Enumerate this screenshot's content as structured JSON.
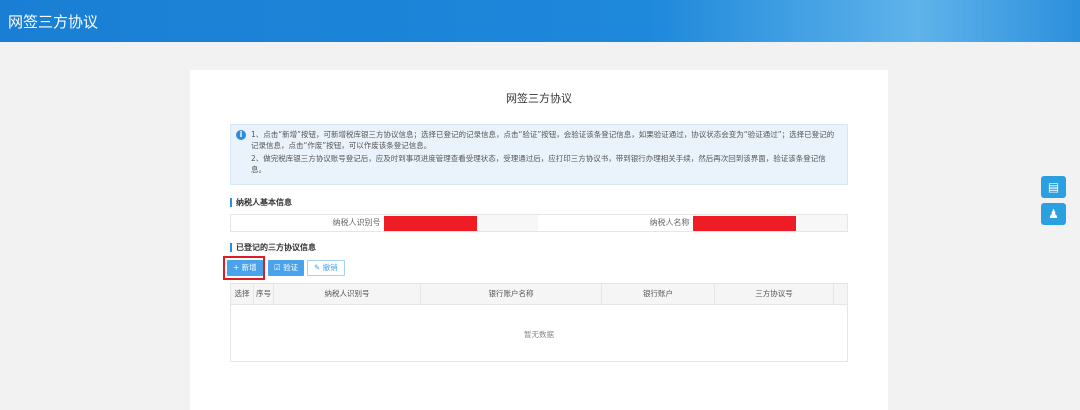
{
  "header": {
    "title": "网签三方协议"
  },
  "page_title": "网签三方协议",
  "notice": {
    "line1": "1、点击“新增”按钮，可新增税库银三方协议信息；选择已登记的记录信息，点击“验证”按钮，会验证该条登记信息，如果验证通过，协议状态会变为“验证通过”；选择已登记的记录信息，点击“作废”按钮，可以作废该条登记信息。",
    "line2": "2、做完税库银三方协议账号登记后，应及时到事项进度管理查看受理状态，受理通过后，应打印三方协议书，带到银行办理相关手续，然后再次回到该界面，验证该条登记信息。"
  },
  "basic": {
    "heading": "纳税人基本信息",
    "taxid_label": "纳税人识别号",
    "name_label": "纳税人名称"
  },
  "registered": {
    "heading": "已登记的三方协议信息",
    "buttons": {
      "add": "+ 新增",
      "verify": "☑ 验证",
      "revoke": "✎ 撤销"
    },
    "columns": [
      "选择",
      "序号",
      "纳税人识别号",
      "银行账户名称",
      "银行账户",
      "三方协议号"
    ],
    "empty": "暂无数据"
  },
  "colors": {
    "accent": "#2d8ce2",
    "redaction": "#ee1c25"
  }
}
